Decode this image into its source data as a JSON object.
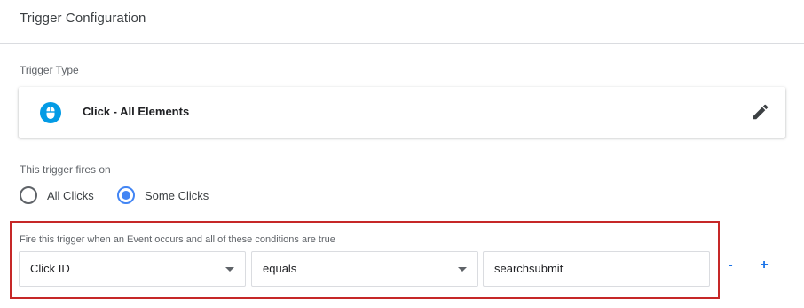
{
  "panel": {
    "title": "Trigger Configuration"
  },
  "trigger_type": {
    "label": "Trigger Type",
    "name": "Click - All Elements",
    "icon": "mouse-icon",
    "icon_color": "#039be5",
    "edit_icon": "pencil-icon"
  },
  "fires_on": {
    "label": "This trigger fires on",
    "options": [
      {
        "label": "All Clicks",
        "selected": false
      },
      {
        "label": "Some Clicks",
        "selected": true
      }
    ]
  },
  "conditions": {
    "description": "Fire this trigger when an Event occurs and all of these conditions are true",
    "highlight_color": "#c62828",
    "rows": [
      {
        "variable": "Click ID",
        "operator": "equals",
        "value": "searchsubmit"
      }
    ],
    "remove_label": "-",
    "add_label": "+"
  },
  "colors": {
    "accent": "#4285f4",
    "link": "#1a73e8"
  }
}
